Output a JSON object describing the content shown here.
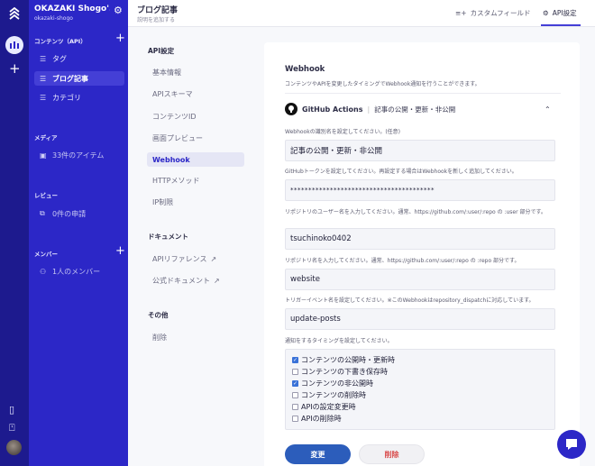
{
  "service": {
    "name": "OKAZAKI Shogo'...",
    "id": "okazaki-shogo"
  },
  "sidebar": {
    "contents_label": "コンテンツ（API）",
    "apis": [
      {
        "label": "タグ"
      },
      {
        "label": "ブログ記事"
      },
      {
        "label": "カテゴリ"
      }
    ],
    "media_label": "メディア",
    "media_item": "33件のアイテム",
    "review_label": "レビュー",
    "review_item": "0件の申請",
    "members_label": "メンバー",
    "members_item": "1人のメンバー"
  },
  "header": {
    "title": "ブログ記事",
    "subtitle": "説明を追加する",
    "custom_fields": "カスタムフィールド",
    "api_settings": "API設定"
  },
  "menu": {
    "api_settings_label": "API設定",
    "items": [
      "基本情報",
      "APIスキーマ",
      "コンテンツID",
      "画面プレビュー",
      "Webhook",
      "HTTPメソッド",
      "IP制限"
    ],
    "docs_label": "ドキュメント",
    "docs": [
      "APIリファレンス",
      "公式ドキュメント"
    ],
    "other_label": "その他",
    "other": [
      "削除"
    ]
  },
  "webhook": {
    "heading": "Webhook",
    "description": "コンテンツやAPIを変更したタイミングでWebhook通知を行うことができます。",
    "provider": "GitHub Actions",
    "provider_value": "記事の公開・更新・非公開",
    "fields": [
      {
        "label": "Webhookの識別名を設定してください。(任意)",
        "value": "記事の公開・更新・非公開"
      },
      {
        "label": "GitHubトークンを設定してください。再設定する場合はWebhookを新しく追加してください。",
        "value": "****************************************"
      },
      {
        "label": "リポジトリのユーザー名を入力してください。通常、https://github.com/:user/:repo の :user 部分です。",
        "value": "tsuchinoko0402"
      },
      {
        "label": "リポジトリ名を入力してください。通常、https://github.com/:user/:repo の :repo 部分です。",
        "value": "website"
      },
      {
        "label": "トリガーイベント名を設定してください。※このWebhookはrepository_dispatchに対応しています。",
        "value": "update-posts"
      }
    ],
    "timing_label": "通知をするタイミングを設定してください。",
    "timings": [
      {
        "label": "コンテンツの公開時・更新時",
        "checked": true
      },
      {
        "label": "コンテンツの下書き保存時",
        "checked": false
      },
      {
        "label": "コンテンツの非公開時",
        "checked": true
      },
      {
        "label": "コンテンツの削除時",
        "checked": false
      },
      {
        "label": "APIの設定変更時",
        "checked": false
      },
      {
        "label": "APIの削除時",
        "checked": false
      }
    ],
    "save_label": "変更",
    "delete_label": "削除"
  },
  "colors": {
    "rail": "#1d1a8e",
    "sidebar": "#2c27c7",
    "accent": "#443fd6",
    "save": "#2c5dbb",
    "delete_text": "#d94a4a"
  },
  "icons": [
    "microcms-logo-icon",
    "app-icon",
    "plus-icon",
    "book-icon",
    "info-icon",
    "gear-icon",
    "list-icon",
    "image-icon",
    "review-icon",
    "user-icon",
    "external-link-icon",
    "github-icon",
    "chevron-up-icon",
    "chat-icon"
  ]
}
